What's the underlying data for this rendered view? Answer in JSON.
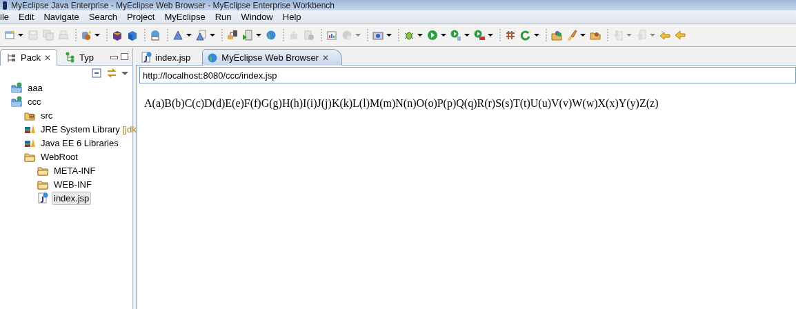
{
  "window": {
    "title": "MyEclipse Java Enterprise - MyEclipse Web Browser - MyEclipse Enterprise Workbench"
  },
  "menu": [
    "ile",
    "Edit",
    "Navigate",
    "Search",
    "Project",
    "MyEclipse",
    "Run",
    "Window",
    "Help"
  ],
  "toolbar": [
    {
      "items": [
        {
          "dropdown": true,
          "disabled": false
        },
        {
          "dropdown": false,
          "disabled": true
        },
        {
          "dropdown": false,
          "disabled": true
        },
        {
          "dropdown": false,
          "disabled": true
        }
      ]
    },
    {
      "items": [
        {
          "dropdown": true,
          "disabled": false
        }
      ]
    },
    {
      "items": [
        {
          "dropdown": false,
          "disabled": false
        },
        {
          "dropdown": false,
          "disabled": false
        }
      ]
    },
    {
      "items": [
        {
          "dropdown": false,
          "disabled": false
        }
      ]
    },
    {
      "items": [
        {
          "dropdown": true,
          "disabled": false
        },
        {
          "dropdown": true,
          "disabled": false
        }
      ]
    },
    {
      "items": [
        {
          "dropdown": false,
          "disabled": false
        },
        {
          "dropdown": true,
          "disabled": false
        },
        {
          "dropdown": false,
          "disabled": false
        }
      ]
    },
    {
      "items": [
        {
          "dropdown": false,
          "disabled": true
        },
        {
          "dropdown": false,
          "disabled": true
        }
      ]
    },
    {
      "items": [
        {
          "dropdown": false,
          "disabled": false
        },
        {
          "dropdown": true,
          "disabled": true
        }
      ]
    },
    {
      "items": [
        {
          "dropdown": true,
          "disabled": false
        }
      ]
    },
    {
      "items": [
        {
          "dropdown": true,
          "disabled": false
        },
        {
          "dropdown": true,
          "disabled": false
        },
        {
          "dropdown": true,
          "disabled": false
        },
        {
          "dropdown": true,
          "disabled": false
        }
      ]
    },
    {
      "items": [
        {
          "dropdown": false,
          "disabled": false
        },
        {
          "dropdown": true,
          "disabled": false
        }
      ]
    },
    {
      "items": [
        {
          "dropdown": false,
          "disabled": false
        },
        {
          "dropdown": true,
          "disabled": false
        },
        {
          "dropdown": false,
          "disabled": false
        }
      ]
    },
    {
      "items": [
        {
          "dropdown": true,
          "disabled": true
        },
        {
          "dropdown": true,
          "disabled": true
        },
        {
          "dropdown": false,
          "disabled": false
        },
        {
          "dropdown": false,
          "disabled": false
        }
      ]
    }
  ],
  "left_panel": {
    "tabs": [
      {
        "label": "Pack",
        "selected": true,
        "close": "✕"
      },
      {
        "label": "Typ",
        "selected": false
      }
    ],
    "tree": [
      {
        "kind": "project",
        "label": "aaa",
        "selected": false
      },
      {
        "kind": "project",
        "label": "ccc",
        "selected": false,
        "children": [
          {
            "kind": "source",
            "label": "src",
            "selected": false
          },
          {
            "kind": "library",
            "label": "JRE System Library",
            "decoration": "[jdk",
            "selected": false
          },
          {
            "kind": "library",
            "label": "Java EE 6 Libraries",
            "selected": false
          },
          {
            "kind": "folder",
            "label": "WebRoot",
            "selected": false,
            "children": [
              {
                "kind": "folder",
                "label": "META-INF",
                "selected": false
              },
              {
                "kind": "folder",
                "label": "WEB-INF",
                "selected": false
              },
              {
                "kind": "jsp",
                "label": "index.jsp",
                "selected": true
              }
            ]
          }
        ]
      }
    ]
  },
  "editor": {
    "tabs": [
      {
        "kind": "jsp",
        "label": "index.jsp",
        "selected": false
      },
      {
        "kind": "browser",
        "label": "MyEclipse Web Browser",
        "selected": true,
        "close": "✕"
      }
    ],
    "address": "http://localhost:8080/ccc/index.jsp",
    "page_text": "A(a)B(b)C(c)D(d)E(e)F(f)G(g)H(h)I(i)J(j)K(k)L(l)M(m)N(n)O(o)P(p)Q(q)R(r)S(s)T(t)U(u)V(v)W(w)X(x)Y(y)Z(z)"
  }
}
